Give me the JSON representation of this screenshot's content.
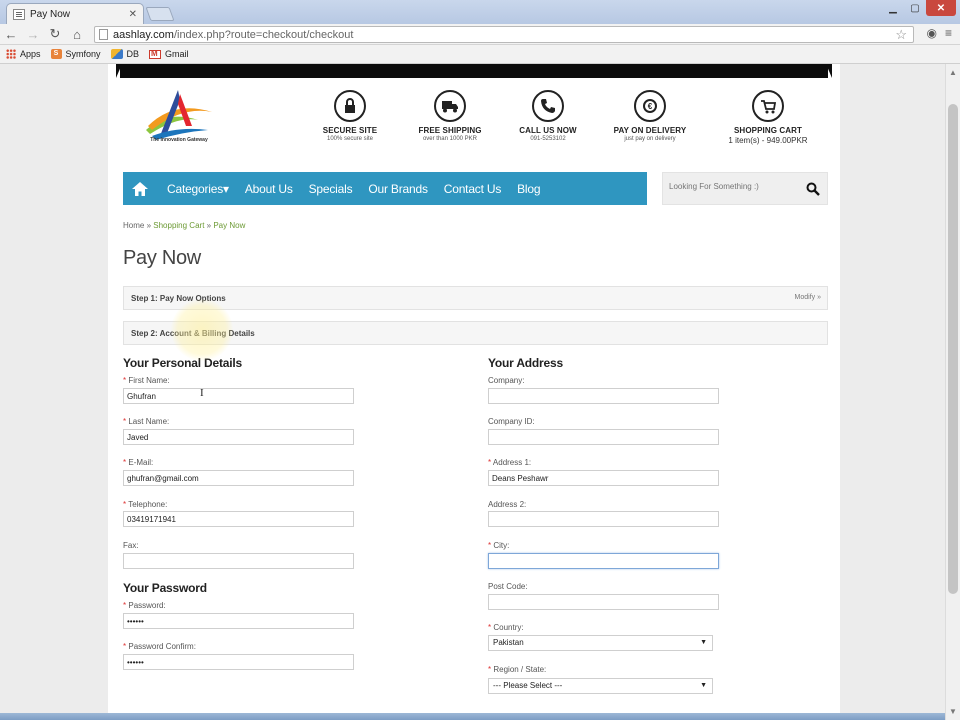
{
  "browser": {
    "tab_title": "Pay Now",
    "url_domain": "aashlay.com",
    "url_path": "/index.php?route=checkout/checkout",
    "bookmarks": [
      {
        "label": "Apps",
        "icon": "apps-icon"
      },
      {
        "label": "Symfony",
        "icon": "symfony-icon"
      },
      {
        "label": "DB",
        "icon": "db-icon"
      },
      {
        "label": "Gmail",
        "icon": "gmail-icon"
      }
    ]
  },
  "header": {
    "logo_tagline": "The Innovation Gateway",
    "features": [
      {
        "title": "SECURE SITE",
        "subtitle": "100% secure site",
        "icon": "lock-icon"
      },
      {
        "title": "FREE SHIPPING",
        "subtitle": "over than 1000 PKR",
        "icon": "truck-icon"
      },
      {
        "title": "CALL US NOW",
        "subtitle": "091-5253102",
        "icon": "phone-icon"
      },
      {
        "title": "PAY ON DELIVERY",
        "subtitle": "just pay on delivery",
        "icon": "cash-icon"
      },
      {
        "title": "SHOPPING CART",
        "subtitle": "1 item(s) - 949.00PKR",
        "icon": "cart-icon"
      }
    ]
  },
  "nav": {
    "items": [
      "Categories▾",
      "About Us",
      "Specials",
      "Our Brands",
      "Contact Us",
      "Blog"
    ],
    "search_placeholder": "Looking For Something :)"
  },
  "breadcrumb": {
    "home": "Home",
    "sep": "»",
    "cart": "Shopping Cart",
    "current": "Pay Now"
  },
  "page_title": "Pay Now",
  "steps": [
    {
      "label": "Step 1: Pay Now Options",
      "modify": "Modify »"
    },
    {
      "label": "Step 2: Account & Billing Details"
    }
  ],
  "personal": {
    "heading": "Your Personal Details",
    "first_name": {
      "label": "First Name:",
      "value": "Ghufran",
      "required": "*"
    },
    "last_name": {
      "label": "Last Name:",
      "value": "Javed",
      "required": "*"
    },
    "email": {
      "label": "E-Mail:",
      "value": "ghufran@gmail.com",
      "required": "*"
    },
    "telephone": {
      "label": "Telephone:",
      "value": "03419171941",
      "required": "*"
    },
    "fax": {
      "label": "Fax:",
      "value": ""
    }
  },
  "password": {
    "heading": "Your Password",
    "password": {
      "label": "Password:",
      "value": "••••••",
      "required": "*"
    },
    "confirm": {
      "label": "Password Confirm:",
      "value": "••••••",
      "required": "*"
    }
  },
  "address": {
    "heading": "Your Address",
    "company": {
      "label": "Company:",
      "value": ""
    },
    "company_id": {
      "label": "Company ID:",
      "value": ""
    },
    "address1": {
      "label": "Address 1:",
      "value": "Deans Peshawr",
      "required": "*"
    },
    "address2": {
      "label": "Address 2:",
      "value": ""
    },
    "city": {
      "label": "City:",
      "value": "",
      "required": "*"
    },
    "post_code": {
      "label": "Post Code:",
      "value": ""
    },
    "country": {
      "label": "Country:",
      "value": "Pakistan",
      "required": "*"
    },
    "region": {
      "label": "Region / State:",
      "value": " --- Please Select --- ",
      "required": "*"
    }
  },
  "colors": {
    "nav_bg": "#2f96c0",
    "breadcrumb_link": "#6c9a34",
    "required": "#dd3333"
  }
}
